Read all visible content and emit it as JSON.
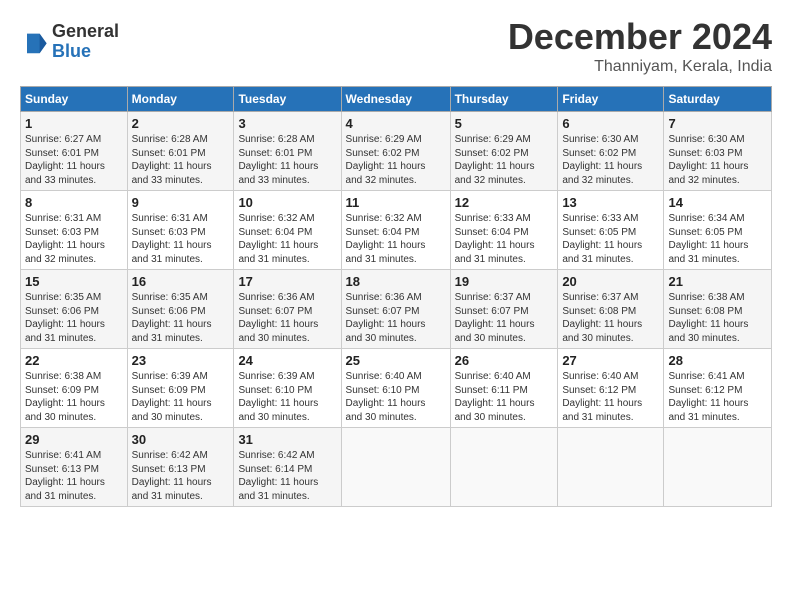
{
  "logo": {
    "general": "General",
    "blue": "Blue"
  },
  "header": {
    "month": "December 2024",
    "location": "Thanniyam, Kerala, India"
  },
  "weekdays": [
    "Sunday",
    "Monday",
    "Tuesday",
    "Wednesday",
    "Thursday",
    "Friday",
    "Saturday"
  ],
  "weeks": [
    [
      {
        "day": "1",
        "info": "Sunrise: 6:27 AM\nSunset: 6:01 PM\nDaylight: 11 hours\nand 33 minutes."
      },
      {
        "day": "2",
        "info": "Sunrise: 6:28 AM\nSunset: 6:01 PM\nDaylight: 11 hours\nand 33 minutes."
      },
      {
        "day": "3",
        "info": "Sunrise: 6:28 AM\nSunset: 6:01 PM\nDaylight: 11 hours\nand 33 minutes."
      },
      {
        "day": "4",
        "info": "Sunrise: 6:29 AM\nSunset: 6:02 PM\nDaylight: 11 hours\nand 32 minutes."
      },
      {
        "day": "5",
        "info": "Sunrise: 6:29 AM\nSunset: 6:02 PM\nDaylight: 11 hours\nand 32 minutes."
      },
      {
        "day": "6",
        "info": "Sunrise: 6:30 AM\nSunset: 6:02 PM\nDaylight: 11 hours\nand 32 minutes."
      },
      {
        "day": "7",
        "info": "Sunrise: 6:30 AM\nSunset: 6:03 PM\nDaylight: 11 hours\nand 32 minutes."
      }
    ],
    [
      {
        "day": "8",
        "info": "Sunrise: 6:31 AM\nSunset: 6:03 PM\nDaylight: 11 hours\nand 32 minutes."
      },
      {
        "day": "9",
        "info": "Sunrise: 6:31 AM\nSunset: 6:03 PM\nDaylight: 11 hours\nand 31 minutes."
      },
      {
        "day": "10",
        "info": "Sunrise: 6:32 AM\nSunset: 6:04 PM\nDaylight: 11 hours\nand 31 minutes."
      },
      {
        "day": "11",
        "info": "Sunrise: 6:32 AM\nSunset: 6:04 PM\nDaylight: 11 hours\nand 31 minutes."
      },
      {
        "day": "12",
        "info": "Sunrise: 6:33 AM\nSunset: 6:04 PM\nDaylight: 11 hours\nand 31 minutes."
      },
      {
        "day": "13",
        "info": "Sunrise: 6:33 AM\nSunset: 6:05 PM\nDaylight: 11 hours\nand 31 minutes."
      },
      {
        "day": "14",
        "info": "Sunrise: 6:34 AM\nSunset: 6:05 PM\nDaylight: 11 hours\nand 31 minutes."
      }
    ],
    [
      {
        "day": "15",
        "info": "Sunrise: 6:35 AM\nSunset: 6:06 PM\nDaylight: 11 hours\nand 31 minutes."
      },
      {
        "day": "16",
        "info": "Sunrise: 6:35 AM\nSunset: 6:06 PM\nDaylight: 11 hours\nand 31 minutes."
      },
      {
        "day": "17",
        "info": "Sunrise: 6:36 AM\nSunset: 6:07 PM\nDaylight: 11 hours\nand 30 minutes."
      },
      {
        "day": "18",
        "info": "Sunrise: 6:36 AM\nSunset: 6:07 PM\nDaylight: 11 hours\nand 30 minutes."
      },
      {
        "day": "19",
        "info": "Sunrise: 6:37 AM\nSunset: 6:07 PM\nDaylight: 11 hours\nand 30 minutes."
      },
      {
        "day": "20",
        "info": "Sunrise: 6:37 AM\nSunset: 6:08 PM\nDaylight: 11 hours\nand 30 minutes."
      },
      {
        "day": "21",
        "info": "Sunrise: 6:38 AM\nSunset: 6:08 PM\nDaylight: 11 hours\nand 30 minutes."
      }
    ],
    [
      {
        "day": "22",
        "info": "Sunrise: 6:38 AM\nSunset: 6:09 PM\nDaylight: 11 hours\nand 30 minutes."
      },
      {
        "day": "23",
        "info": "Sunrise: 6:39 AM\nSunset: 6:09 PM\nDaylight: 11 hours\nand 30 minutes."
      },
      {
        "day": "24",
        "info": "Sunrise: 6:39 AM\nSunset: 6:10 PM\nDaylight: 11 hours\nand 30 minutes."
      },
      {
        "day": "25",
        "info": "Sunrise: 6:40 AM\nSunset: 6:10 PM\nDaylight: 11 hours\nand 30 minutes."
      },
      {
        "day": "26",
        "info": "Sunrise: 6:40 AM\nSunset: 6:11 PM\nDaylight: 11 hours\nand 30 minutes."
      },
      {
        "day": "27",
        "info": "Sunrise: 6:40 AM\nSunset: 6:12 PM\nDaylight: 11 hours\nand 31 minutes."
      },
      {
        "day": "28",
        "info": "Sunrise: 6:41 AM\nSunset: 6:12 PM\nDaylight: 11 hours\nand 31 minutes."
      }
    ],
    [
      {
        "day": "29",
        "info": "Sunrise: 6:41 AM\nSunset: 6:13 PM\nDaylight: 11 hours\nand 31 minutes."
      },
      {
        "day": "30",
        "info": "Sunrise: 6:42 AM\nSunset: 6:13 PM\nDaylight: 11 hours\nand 31 minutes."
      },
      {
        "day": "31",
        "info": "Sunrise: 6:42 AM\nSunset: 6:14 PM\nDaylight: 11 hours\nand 31 minutes."
      },
      null,
      null,
      null,
      null
    ]
  ]
}
